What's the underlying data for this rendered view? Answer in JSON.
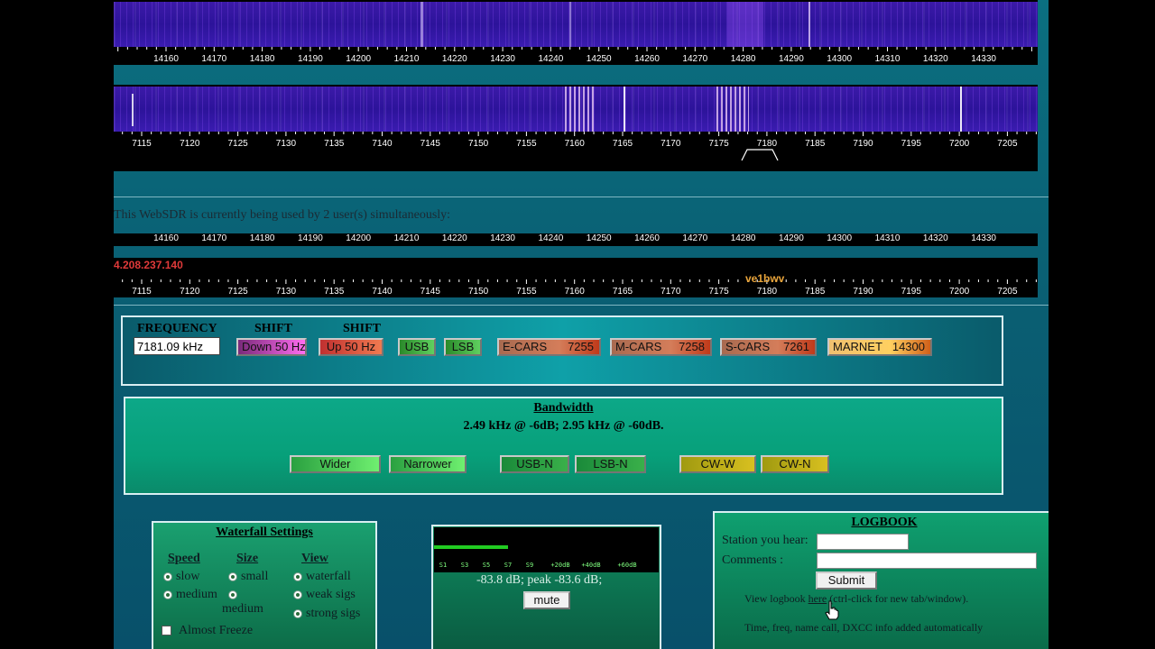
{
  "spectrum_top": {
    "scale_labels": [
      "14160",
      "14170",
      "14180",
      "14190",
      "14200",
      "14210",
      "14220",
      "14230",
      "14240",
      "14250",
      "14260",
      "14270",
      "14280",
      "14290",
      "14300",
      "14310",
      "14320",
      "14330"
    ]
  },
  "spectrum_bottom": {
    "scale_labels": [
      "7115",
      "7120",
      "7125",
      "7130",
      "7135",
      "7140",
      "7145",
      "7150",
      "7155",
      "7160",
      "7165",
      "7170",
      "7175",
      "7180",
      "7185",
      "7190",
      "7195",
      "7200",
      "7205"
    ]
  },
  "status": {
    "users_text": "This WebSDR is currently being used by 2 user(s) simultaneously:",
    "user_ip": "4.208.237.140",
    "user_callsign": "ve1bwv"
  },
  "tuning": {
    "frequency_header": "FREQUENCY",
    "shift_header_1": "SHIFT",
    "shift_header_2": "SHIFT",
    "frequency_value": "7181.09 kHz",
    "down_label": "Down 50 Hz",
    "up_label": "Up 50 Hz",
    "usb_label": "USB",
    "lsb_label": "LSB",
    "presets": [
      {
        "name": "E-CARS",
        "freq": "7255"
      },
      {
        "name": "M-CARS",
        "freq": "7258"
      },
      {
        "name": "S-CARS",
        "freq": "7261"
      },
      {
        "name": "MARNET",
        "freq": "14300"
      }
    ]
  },
  "bandwidth": {
    "title": "Bandwidth",
    "info": "2.49 kHz @ -6dB; 2.95 kHz @ -60dB.",
    "wider": "Wider",
    "narrower": "Narrower",
    "usb_n": "USB-N",
    "lsb_n": "LSB-N",
    "cw_w": "CW-W",
    "cw_n": "CW-N"
  },
  "waterfall_settings": {
    "title": "Waterfall Settings",
    "speed_header": "Speed",
    "size_header": "Size",
    "view_header": "View",
    "speed_slow": "slow",
    "speed_medium": "medium",
    "size_small": "small",
    "size_medium": "medium",
    "view_waterfall": "waterfall",
    "view_weak": "weak sigs",
    "view_strong": "strong sigs",
    "almost_freeze": "Almost Freeze"
  },
  "smeter": {
    "labels": [
      "S1",
      "S3",
      "S5",
      "S7",
      "S9",
      "+20dB",
      "+40dB",
      "+60dB"
    ],
    "level_text": "-83.8 dB; peak -83.6 dB;",
    "mute_label": "mute",
    "level_fraction": 0.33
  },
  "logbook": {
    "title": "LOGBOOK",
    "station_label": "Station you hear:",
    "comments_label": "Comments :",
    "station_value": "",
    "comments_value": "",
    "submit_label": "Submit",
    "view_text_1": "View  logbook",
    "view_link": "here",
    "view_text_2": "(ctrl-click for new tab/window).",
    "auto_info": "Time, freq, name call, DXCC info added automatically"
  },
  "colors": {
    "page_bg": "#0a6678",
    "waterfall": "#3b1aa8",
    "ip_text": "#e03a3a",
    "callsign_text": "#e9a43a"
  }
}
